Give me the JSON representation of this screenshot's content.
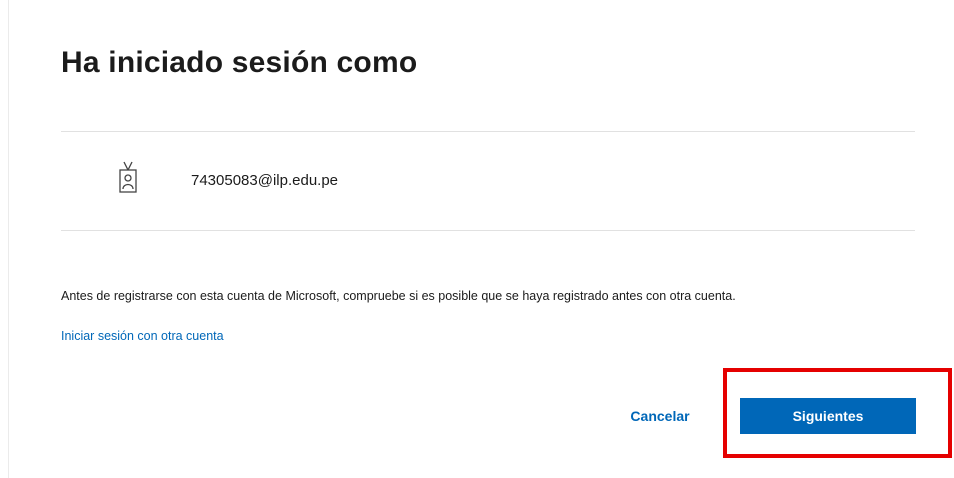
{
  "heading": {
    "title": "Ha iniciado sesión como"
  },
  "account": {
    "icon": "badge-icon",
    "email": "74305083@ilp.edu.pe"
  },
  "notice": {
    "text": "Antes de registrarse con esta cuenta de Microsoft, compruebe si es posible que se haya registrado antes con otra cuenta."
  },
  "links": {
    "other_account": "Iniciar sesión con otra cuenta"
  },
  "actions": {
    "cancel_label": "Cancelar",
    "next_label": "Siguientes"
  },
  "colors": {
    "accent": "#0067b8",
    "highlight": "#e50000",
    "text": "#1b1b1b",
    "divider": "#e1e1e1"
  }
}
